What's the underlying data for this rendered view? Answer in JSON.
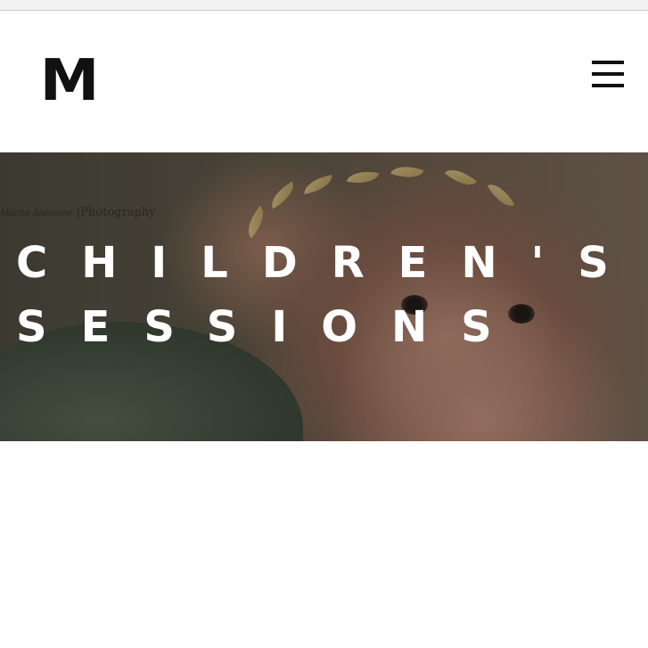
{
  "header": {
    "logo_text": "M",
    "menu_icon": "hamburger-menu-icon"
  },
  "hero": {
    "watermark_script": "Marita Jouvenne",
    "watermark_text": "|Photography",
    "title_line1": "CHILDREN'S",
    "title_line2": "SESSIONS"
  },
  "colors": {
    "title_text": "#ffffff",
    "logo": "#111111",
    "background": "#ffffff"
  }
}
